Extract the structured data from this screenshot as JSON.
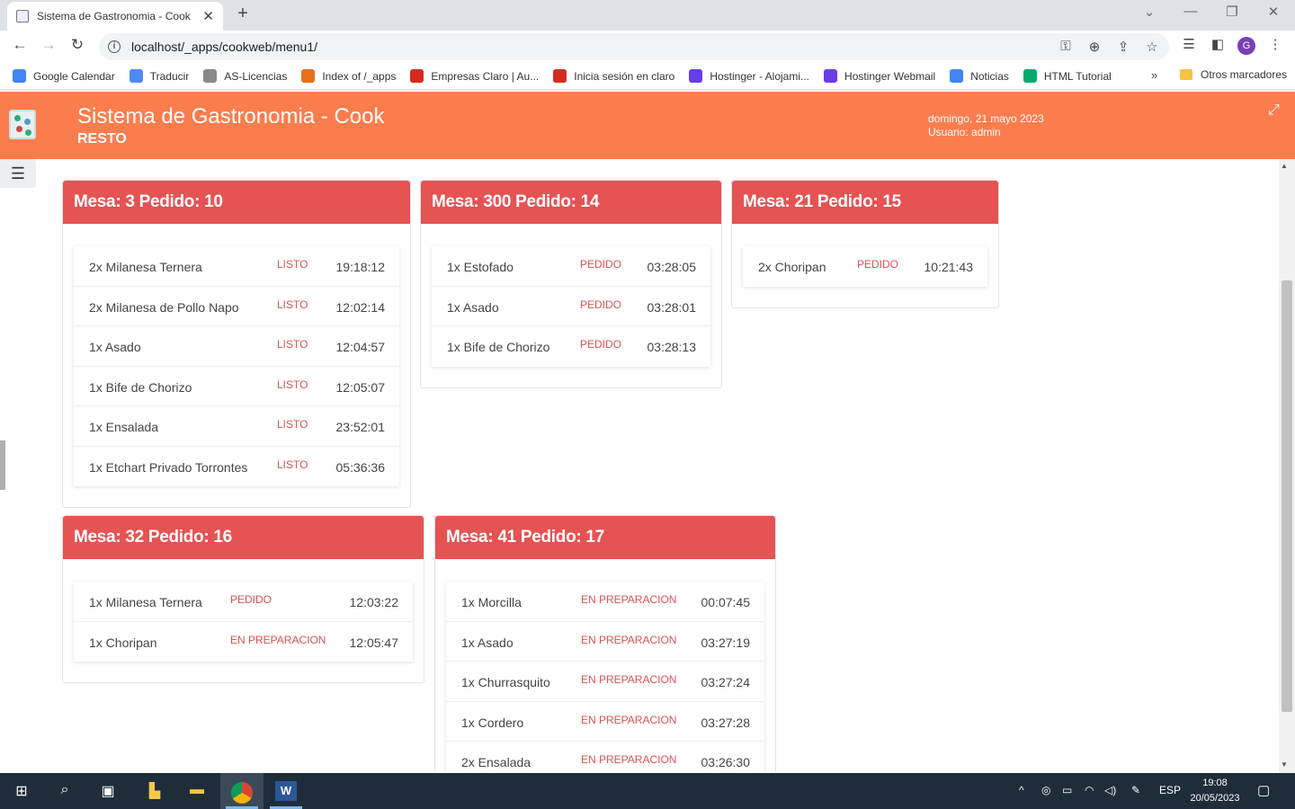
{
  "browser": {
    "tab_title": "Sistema de Gastronomia - Cook",
    "tab_close": "✕",
    "new_tab": "+",
    "url": "localhost/_apps/cookweb/menu1/",
    "avatar_letter": "G",
    "bookmarks": [
      {
        "label": "Google Calendar",
        "color": "#4285f4"
      },
      {
        "label": "Traducir",
        "color": "#4c8bf5"
      },
      {
        "label": "AS-Licencias",
        "color": "#888888"
      },
      {
        "label": "Index of /_apps",
        "color": "#e8711c"
      },
      {
        "label": "Empresas Claro | Au...",
        "color": "#d52b1e"
      },
      {
        "label": "Inicia sesión en claro",
        "color": "#d52b1e"
      },
      {
        "label": "Hostinger - Alojami...",
        "color": "#673de6"
      },
      {
        "label": "Hostinger Webmail",
        "color": "#673de6"
      },
      {
        "label": "Noticias",
        "color": "#4285f4"
      },
      {
        "label": "HTML Tutorial",
        "color": "#04aa6d"
      }
    ],
    "bookmarks_more": "»",
    "other_bookmarks": "Otros marcadores"
  },
  "app": {
    "title": "Sistema de Gastronomia - Cook",
    "subtitle": "RESTO",
    "date": "domingo, 21 mayo 2023",
    "user": "Usuario: admin",
    "accent": "#fb7d4d",
    "card_header": "#e55353"
  },
  "orders": [
    {
      "title": "Mesa: 3 Pedido: 10",
      "items": [
        {
          "name": "2x Milanesa Ternera",
          "status": "LISTO",
          "time": "19:18:12"
        },
        {
          "name": "2x Milanesa de Pollo Napo",
          "status": "LISTO",
          "time": "12:02:14"
        },
        {
          "name": "1x Asado",
          "status": "LISTO",
          "time": "12:04:57"
        },
        {
          "name": "1x Bife de Chorizo",
          "status": "LISTO",
          "time": "12:05:07"
        },
        {
          "name": "1x Ensalada",
          "status": "LISTO",
          "time": "23:52:01"
        },
        {
          "name": "1x Etchart Privado Torrontes",
          "status": "LISTO",
          "time": "05:36:36"
        }
      ]
    },
    {
      "title": "Mesa: 300 Pedido: 14",
      "items": [
        {
          "name": "1x Estofado",
          "status": "PEDIDO",
          "time": "03:28:05"
        },
        {
          "name": "1x Asado",
          "status": "PEDIDO",
          "time": "03:28:01"
        },
        {
          "name": "1x Bife de Chorizo",
          "status": "PEDIDO",
          "time": "03:28:13"
        }
      ]
    },
    {
      "title": "Mesa: 21 Pedido: 15",
      "items": [
        {
          "name": "2x Choripan",
          "status": "PEDIDO",
          "time": "10:21:43"
        }
      ]
    },
    {
      "title": "Mesa: 32 Pedido: 16",
      "items": [
        {
          "name": "1x Milanesa Ternera",
          "status": "PEDIDO",
          "time": "12:03:22"
        },
        {
          "name": "1x Choripan",
          "status": "EN PREPARACION",
          "time": "12:05:47"
        }
      ]
    },
    {
      "title": "Mesa: 41 Pedido: 17",
      "items": [
        {
          "name": "1x Morcilla",
          "status": "EN PREPARACION",
          "time": "00:07:45"
        },
        {
          "name": "1x Asado",
          "status": "EN PREPARACION",
          "time": "03:27:19"
        },
        {
          "name": "1x Churrasquito",
          "status": "EN PREPARACION",
          "time": "03:27:24"
        },
        {
          "name": "1x Cordero",
          "status": "EN PREPARACION",
          "time": "03:27:28"
        },
        {
          "name": "2x Ensalada",
          "status": "EN PREPARACION",
          "time": "03:26:30"
        }
      ]
    }
  ],
  "taskbar": {
    "lang": "ESP",
    "time": "19:08",
    "date": "20/05/2023"
  }
}
